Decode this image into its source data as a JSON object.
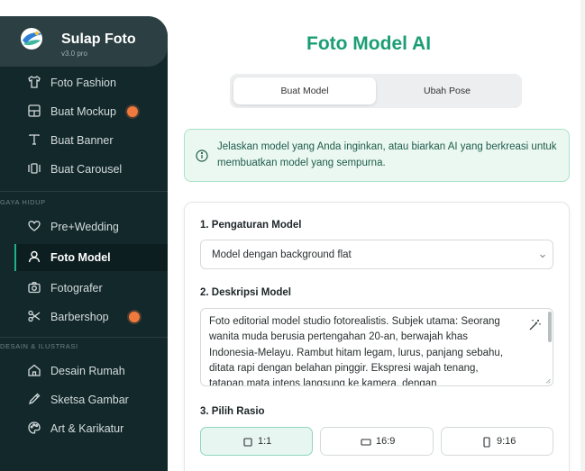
{
  "brand": {
    "title": "Sulap Foto",
    "version": "v3.0 pro"
  },
  "sidebar": {
    "items_top": [
      {
        "label": "Foto Fashion",
        "icon": "shirt-icon"
      },
      {
        "label": "Buat Mockup",
        "icon": "layout-icon",
        "badge": true
      },
      {
        "label": "Buat Banner",
        "icon": "type-icon"
      },
      {
        "label": "Buat Carousel",
        "icon": "carousel-icon"
      }
    ],
    "section_lifestyle": "GAYA HIDUP",
    "items_lifestyle": [
      {
        "label": "Pre+Wedding",
        "icon": "heart-icon"
      },
      {
        "label": "Foto Model",
        "icon": "user-icon",
        "active": true
      },
      {
        "label": "Fotografer",
        "icon": "camera-icon"
      },
      {
        "label": "Barbershop",
        "icon": "scissors-icon",
        "badge": true
      }
    ],
    "section_design": "DESAIN & ILUSTRASI",
    "items_design": [
      {
        "label": "Desain Rumah",
        "icon": "home-icon"
      },
      {
        "label": "Sketsa Gambar",
        "icon": "pencil-icon"
      },
      {
        "label": "Art & Karikatur",
        "icon": "palette-icon"
      }
    ]
  },
  "main": {
    "title": "Foto Model AI",
    "tabs": [
      {
        "label": "Buat Model",
        "active": true
      },
      {
        "label": "Ubah Pose",
        "active": false
      }
    ],
    "info": "Jelaskan model yang Anda inginkan, atau biarkan AI yang berkreasi untuk membuatkan model yang sempurna.",
    "settings_title": "1. Pengaturan Model",
    "settings_value": "Model dengan background flat",
    "description_title": "2. Deskripsi Model",
    "description_text": "Foto editorial model studio fotorealistis. Subjek utama: Seorang wanita muda berusia pertengahan 20-an, berwajah khas Indonesia-Melayu. Rambut hitam legam, lurus, panjang sebahu, ditata rapi dengan belahan pinggir. Ekspresi wajah tenang, tatapan mata intens langsung ke kamera, dengan",
    "ratio_title": "3. Pilih Rasio",
    "ratios": [
      {
        "label": "1:1",
        "active": true
      },
      {
        "label": "16:9",
        "active": false
      },
      {
        "label": "9:16",
        "active": false
      }
    ]
  },
  "colors": {
    "accent": "#1c9e74",
    "sidebar_bg": "#13282b",
    "badge": "#f0793e",
    "info_bg": "#eaf8f1"
  }
}
